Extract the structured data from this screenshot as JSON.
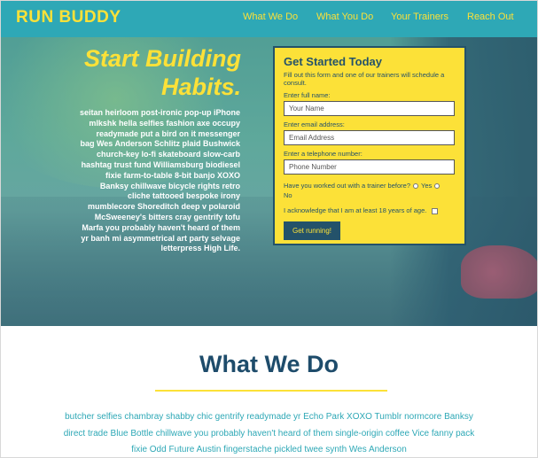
{
  "header": {
    "logo": "RUN BUDDY",
    "nav": [
      "What We Do",
      "What You Do",
      "Your Trainers",
      "Reach Out"
    ]
  },
  "hero": {
    "title_line1": "Start Building",
    "title_line2": "Habits.",
    "body": "seitan heirloom post-ironic pop-up iPhone mlkshk hella selfies fashion axe occupy readymade put a bird on it messenger bag Wes Anderson Schlitz plaid Bushwick church-key lo-fi skateboard slow-carb hashtag trust fund Williamsburg biodiesel fixie farm-to-table 8-bit banjo XOXO Banksy chillwave bicycle rights retro cliche tattooed bespoke irony mumblecore Shoreditch deep v polaroid McSweeney's bitters cray gentrify tofu Marfa you probably haven't heard of them yr banh mi asymmetrical art party selvage letterpress High Life."
  },
  "form": {
    "title": "Get Started Today",
    "subtitle": "Fill out this form and one of our trainers will schedule a consult.",
    "name_label": "Enter full name:",
    "name_placeholder": "Your Name",
    "email_label": "Enter email address:",
    "email_placeholder": "Email Address",
    "phone_label": "Enter a telephone number:",
    "phone_placeholder": "Phone Number",
    "trainer_question": "Have you worked out with a trainer before?",
    "yes_label": "Yes",
    "no_label": "No",
    "age_ack": "I acknowledge that I am at least 18 years of age.",
    "submit": "Get running!"
  },
  "section": {
    "title": "What We Do",
    "text": "butcher selfies chambray shabby chic gentrify readymade yr Echo Park XOXO Tumblr normcore Banksy direct trade Blue Bottle chillwave you probably haven't heard of them single-origin coffee Vice fanny pack fixie Odd Future Austin fingerstache pickled twee synth Wes Anderson"
  },
  "colors": {
    "header_bg": "#2ea8b6",
    "accent_yellow": "#fce138",
    "navy": "#24526a"
  }
}
